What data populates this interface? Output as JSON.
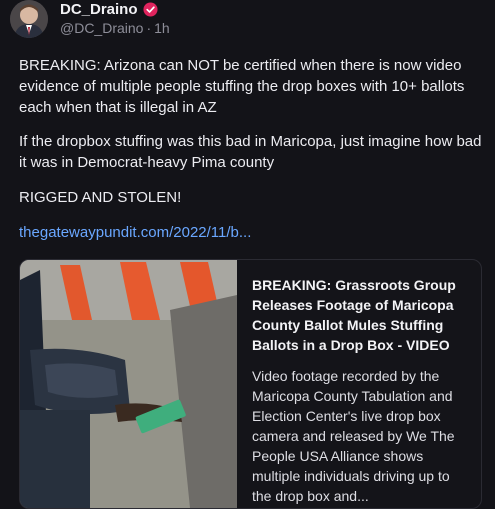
{
  "post": {
    "display_name": "DC_Draino",
    "handle": "@DC_Draino",
    "separator": "·",
    "time": "1h",
    "paragraph_1": "BREAKING: Arizona can NOT be certified when there is now video evidence of multiple people stuffing the drop boxes with 10+ ballots each when that is illegal in AZ",
    "paragraph_2": "If the dropbox stuffing was this bad in Maricopa, just imagine how bad it was in Democrat-heavy Pima county",
    "paragraph_3": "RIGGED AND STOLEN!",
    "link_text": "thegatewaypundit.com/2022/11/b..."
  },
  "link_card": {
    "title": "BREAKING: Grassroots Group Releases Footage of Maricopa County Ballot Mules Stuffing Ballots in a Drop Box - VIDEO",
    "description": "Video footage recorded by the Maricopa County Tabulation and Election Center's live drop box camera and released by We The People USA Alliance shows multiple individuals driving up to the drop box and..."
  },
  "colors": {
    "background": "#131318",
    "link": "#6aa7ff",
    "verified_badge": "#e0245e"
  },
  "icons": {
    "verified": "verified-badge-icon",
    "avatar": "profile-photo"
  }
}
